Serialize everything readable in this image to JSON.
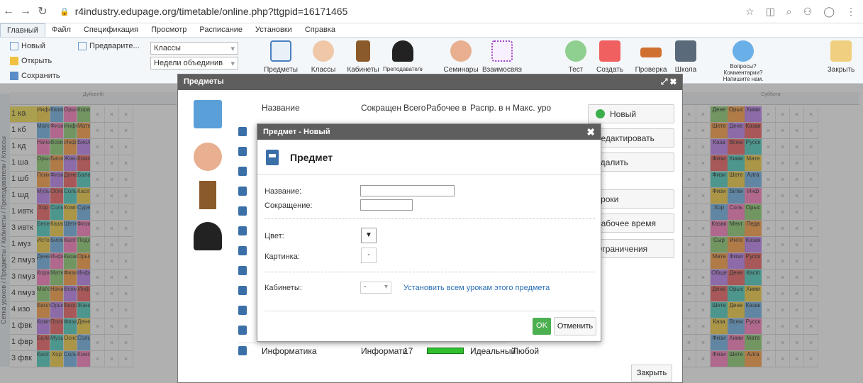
{
  "browser": {
    "url": "r4industry.edupage.org/timetable/online.php?ttgpid=16171465"
  },
  "menu": [
    "Главный",
    "Файл",
    "Спецификация",
    "Просмотр",
    "Расписание",
    "Установки",
    "Справка"
  ],
  "ribbon": {
    "new": "Новый",
    "open": "Открыть",
    "save": "Сохранить",
    "preview": "Предварите...",
    "select1": "Классы",
    "select2": "Недели объединив",
    "big": [
      "Предметы",
      "Классы",
      "Кабинеты",
      "Преподаватели",
      "Семинары",
      "Взаимосвязи",
      "Тест",
      "Создать",
      "Проверка",
      "Школа"
    ],
    "feedback": "Вопросы? Комментарии? Напишите нам.",
    "close": "Закрыть"
  },
  "timetable": {
    "side_label": "Сетка уроков / Предметы / Кабинеты / Преподаватели / Классы",
    "day_left": "Дүйсенбі",
    "day_right": "Суббота",
    "rows": [
      "1 ка",
      "1 кб",
      "1 кд",
      "1 ша",
      "1 шб",
      "1 шд",
      "1 ивтк",
      "3 ивтк",
      "1 муз",
      "2 пмуз",
      "3 пмуз",
      "4 пмуз",
      "4 изо",
      "1 фвк",
      "1 фвр",
      "3 фвк"
    ],
    "cells": [
      "Инфо",
      "Казак",
      "Орыс",
      "Кораи",
      "Мате",
      "Физи",
      "Инфо",
      "Мате",
      "Нача",
      "Всем",
      "Инф",
      "Биол",
      "Орыс",
      "Биол",
      "Жана",
      "Комп",
      "Псих",
      "Физи",
      "Дене",
      "Бала",
      "Музы",
      "Осно",
      "Соль",
      "Касіп",
      "Хор",
      "Соль",
      "Комп",
      "Суре",
      "Бесе",
      "Казак",
      "Шете",
      "Физи",
      "Исто",
      "Биом",
      "Касіп",
      "Педа",
      "Дене"
    ],
    "right_cells": [
      "Дене",
      "Орыс",
      "Хими",
      "Шете",
      "Дене",
      "Казак",
      "Каза",
      "Всем",
      "Русск",
      "Физи",
      "Хими",
      "Мате",
      "Физи",
      "Шете",
      "Алга",
      "Физи",
      "Білім",
      "Инф",
      "Хор",
      "Соль",
      "Орыс",
      "Казак",
      "Мект",
      "Педа",
      "Сыр",
      "Инте",
      "Казак",
      "Мате",
      "Физи",
      "Русск",
      "Обще",
      "Дене",
      "Касіп"
    ]
  },
  "dialog": {
    "title": "Предметы",
    "columns": [
      "Название",
      "Сокращен",
      "Всего",
      "Рабочее в",
      "Распр. в н",
      "Макс. уро"
    ],
    "last_row": {
      "name": "Информатика",
      "short": "Информати",
      "count": "17",
      "dist": "Идеальный",
      "max": "Любой"
    },
    "buttons": [
      "Новый",
      "Редактировать",
      "Удалить",
      "Уроки",
      "Рабочее время",
      "Ограничения"
    ],
    "close": "Закрыть"
  },
  "subdialog": {
    "title": "Предмет - Новый",
    "heading": "Предмет",
    "name_label": "Название:",
    "short_label": "Сокращение:",
    "color_label": "Цвет:",
    "picture_label": "Картинка:",
    "picture_value": "-",
    "rooms_label": "Кабинеты:",
    "rooms_value": "-",
    "rooms_link": "Установить всем урокам этого предмета",
    "ok": "OK",
    "cancel": "Отменить"
  }
}
